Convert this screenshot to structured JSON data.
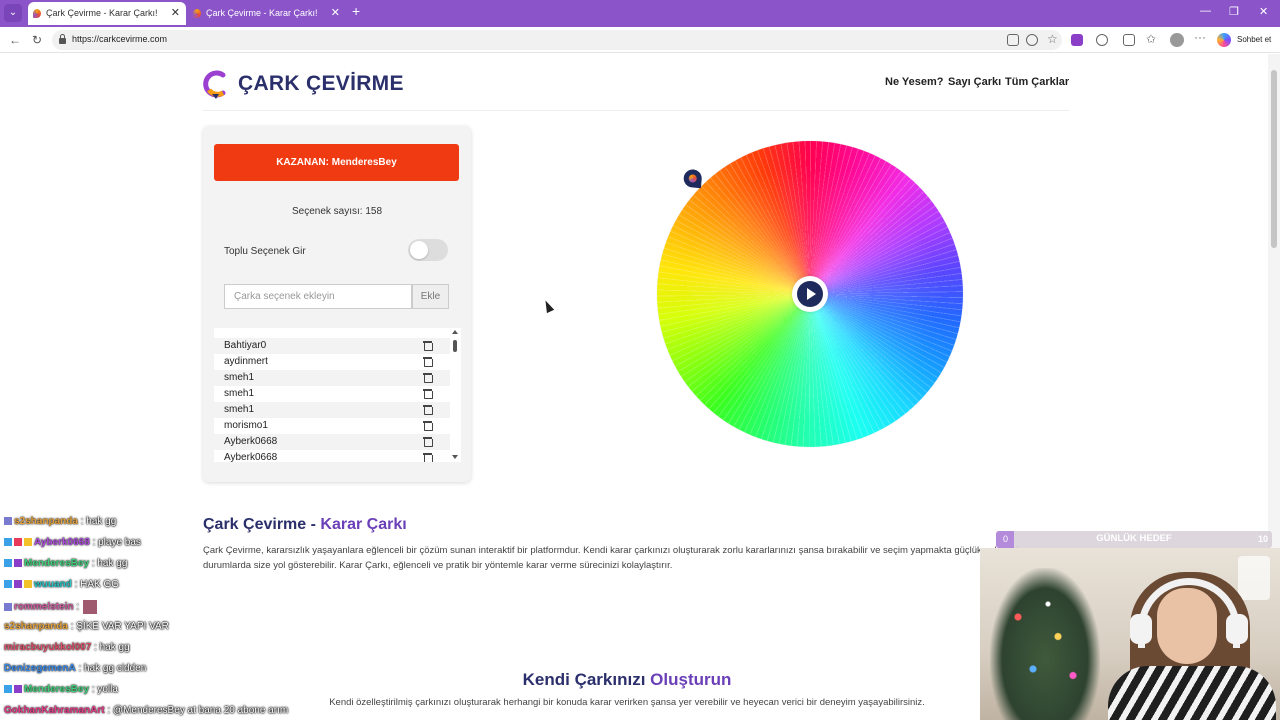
{
  "browser": {
    "tabs": [
      {
        "title": "Çark Çevirme - Karar Çarkı!",
        "active": true
      },
      {
        "title": "Çark Çevirme - Karar Çarkı!",
        "active": false
      }
    ],
    "url": "https://carkcevirme.com",
    "copilot_label": "Sohbet et"
  },
  "site": {
    "brand": "ÇARK ÇEVİRME",
    "nav": [
      "Ne Yesem?",
      "Sayı Çarkı",
      "Tüm Çarklar"
    ]
  },
  "panel": {
    "winner_label": "KAZANAN: MenderesBey",
    "count_label": "Seçenek sayısı: 158",
    "bulk_label": "Toplu Seçenek Gir",
    "bulk_enabled": false,
    "input_placeholder": "Çarka seçenek ekleyin",
    "add_button": "Ekle",
    "items": [
      "Bahtiyar0",
      "aydinmert",
      "smeh1",
      "smeh1",
      "smeh1",
      "morismo1",
      "Ayberk0668",
      "Ayberk0668"
    ]
  },
  "wheel": {
    "segments": 158
  },
  "section1": {
    "title_main": "Çark Çevirme - ",
    "title_accent": "Karar Çarkı",
    "text": "Çark Çevirme, kararsızlık yaşayanlara eğlenceli bir çözüm sunan interaktif bir platformdur. Kendi karar çarkınızı oluşturarak zorlu kararlarınızı şansa bırakabilir ve seçim yapmakta güçlük çektiğiniz durumlarda size yol gösterebilir. Karar Çarkı, eğlenceli ve pratik bir yöntemle karar verme sürecinizi kolaylaştırır."
  },
  "section2": {
    "title_main": "Kendi Çarkınızı ",
    "title_accent": "Oluşturun",
    "text": "Kendi özelleştirilmiş çarkınızı oluşturarak herhangi bir konuda karar verirken şansa yer verebilir ve heyecan verici bir deneyim yaşayabilirsiniz."
  },
  "chat": [
    {
      "user": "s2shanpanda",
      "color": "#e8a33a",
      "msg": ": hak gg"
    },
    {
      "user": "Ayberk0668",
      "color": "#b04ae0",
      "msg": ": playe bas"
    },
    {
      "user": "MenderesBey",
      "color": "#3fd07a",
      "msg": ": hak gg"
    },
    {
      "user": "wuuand",
      "color": "#26c5c5",
      "msg": ": HAK GG"
    },
    {
      "user": "rommelstein",
      "color": "#d05aa0",
      "msg": ":"
    },
    {
      "user": "s2shanpanda",
      "color": "#e8a33a",
      "msg": ": ŞİKE VAR YAPI VAR"
    },
    {
      "user": "miracbuyukkol007",
      "color": "#e0506a",
      "msg": ": hak gg"
    },
    {
      "user": "DenizegemenA",
      "color": "#3a8ae8",
      "msg": ": hak gg cidden"
    },
    {
      "user": "MenderesBey",
      "color": "#3fd07a",
      "msg": ": yolla"
    },
    {
      "user": "GokhanKahramanArt",
      "color": "#e83a8a",
      "msg": ": @MenderesBey at bana 20 abone arım"
    }
  ],
  "goal": {
    "label": "GÜNLÜK HEDEF",
    "current": "0",
    "target": "10",
    "progress": 0
  }
}
